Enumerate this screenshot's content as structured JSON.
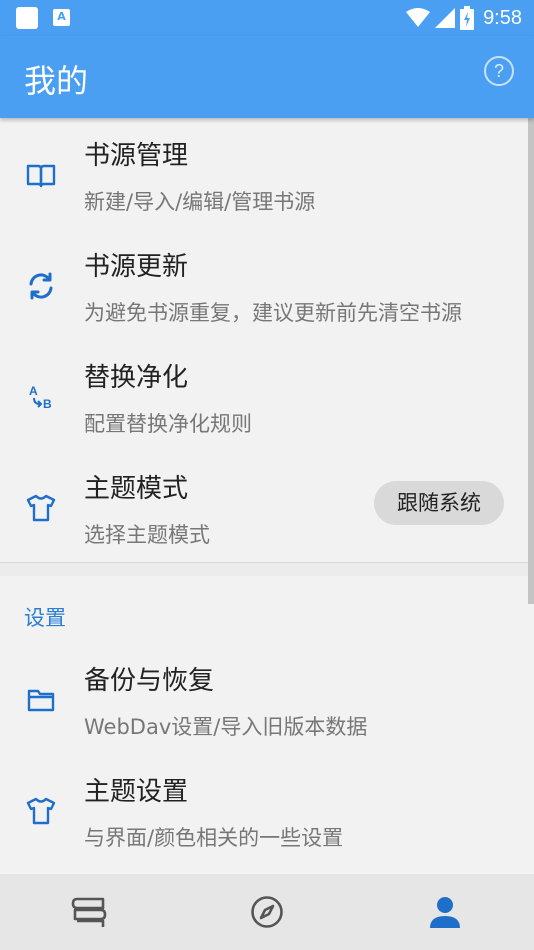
{
  "status_bar": {
    "time": "9:58",
    "notification_letter": "A"
  },
  "app_bar": {
    "title": "我的",
    "help_symbol": "?"
  },
  "main_items": [
    {
      "title": "书源管理",
      "subtitle": "新建/导入/编辑/管理书源",
      "icon": "book-open-icon"
    },
    {
      "title": "书源更新",
      "subtitle": "为避免书源重复，建议更新前先清空书源",
      "icon": "sync-icon"
    },
    {
      "title": "替换净化",
      "subtitle": "配置替换净化规则",
      "icon": "replace-ab-icon"
    },
    {
      "title": "主题模式",
      "subtitle": "选择主题模式",
      "icon": "tshirt-icon",
      "value": "跟随系统"
    }
  ],
  "settings_section": {
    "title": "设置",
    "items": [
      {
        "title": "备份与恢复",
        "subtitle": "WebDav设置/导入旧版本数据",
        "icon": "folder-icon"
      },
      {
        "title": "主题设置",
        "subtitle": "与界面/颜色相关的一些设置",
        "icon": "tshirt-icon"
      }
    ]
  },
  "bottom_nav": [
    {
      "name": "bookshelf",
      "icon": "bookshelf-icon",
      "active": false
    },
    {
      "name": "explore",
      "icon": "compass-icon",
      "active": false
    },
    {
      "name": "my",
      "icon": "person-icon",
      "active": true
    }
  ],
  "colors": {
    "primary": "#4a9ff2",
    "accent": "#2a7fd4",
    "icon_blue": "#1e6fc9",
    "background": "#f2f2f2"
  }
}
